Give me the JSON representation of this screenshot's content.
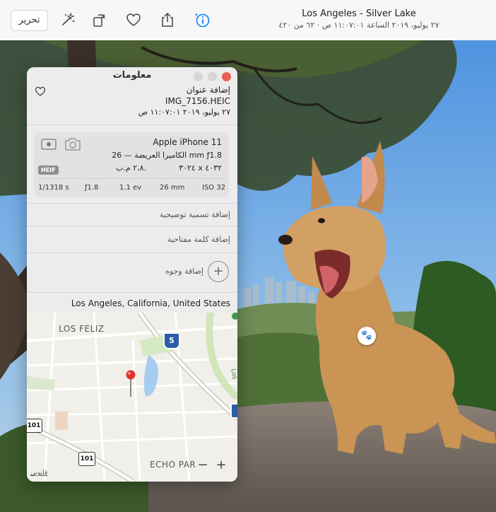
{
  "toolbar": {
    "edit_label": "تحرير",
    "title": "Los Angeles - Silver Lake",
    "subtitle": "٢٧ يوليو، ٢٠١٩ الساعة ١١:٠٧:٠١ ص  ·  ٦٢ من ٤٢٠"
  },
  "info_panel": {
    "window_title": "معلومات",
    "add_title": "إضافة عنوان",
    "filename": "IMG_7156.HEIC",
    "datetime": "٢٧ يوليو، ٢٠١٩  ١١:٠٧:٠١ ص",
    "camera": {
      "model": "Apple iPhone 11",
      "lens": "الكاميرا العريضة — 26 mm  ƒ1.8",
      "dimensions": "٣٠٢٤ x ٤٠٣٢",
      "megapixels": "٢،٨ م.ب.",
      "format_badge": "HEIF",
      "specs": [
        "1/1318 s",
        "ƒ1.8",
        "1.1 ev",
        "26 mm",
        "ISO 32"
      ]
    },
    "add_caption": "إضافة تسمية توضيحية",
    "add_keyword": "إضافة كلمة مفتاحية",
    "add_faces": "إضافة وجوه",
    "location": "Los Angeles, California, United States",
    "map": {
      "label_los_feliz": "LOS FELIZ",
      "label_echo_park": "ECHO PAR",
      "label_los": "Los",
      "shield_5": "5",
      "shield_101_a": "101",
      "shield_101_b": "101",
      "zoom_out": "−",
      "zoom_in": "+",
      "legal": "قانوني"
    }
  },
  "colors": {
    "accent": "#0a84ff",
    "close": "#ec5f57",
    "pin": "#e0302a"
  },
  "icons": [
    "magic-wand-icon",
    "rotate-icon",
    "heart-icon",
    "share-icon",
    "info-icon",
    "paw-icon",
    "camera-icon",
    "live-photo-icon",
    "plus-icon"
  ]
}
